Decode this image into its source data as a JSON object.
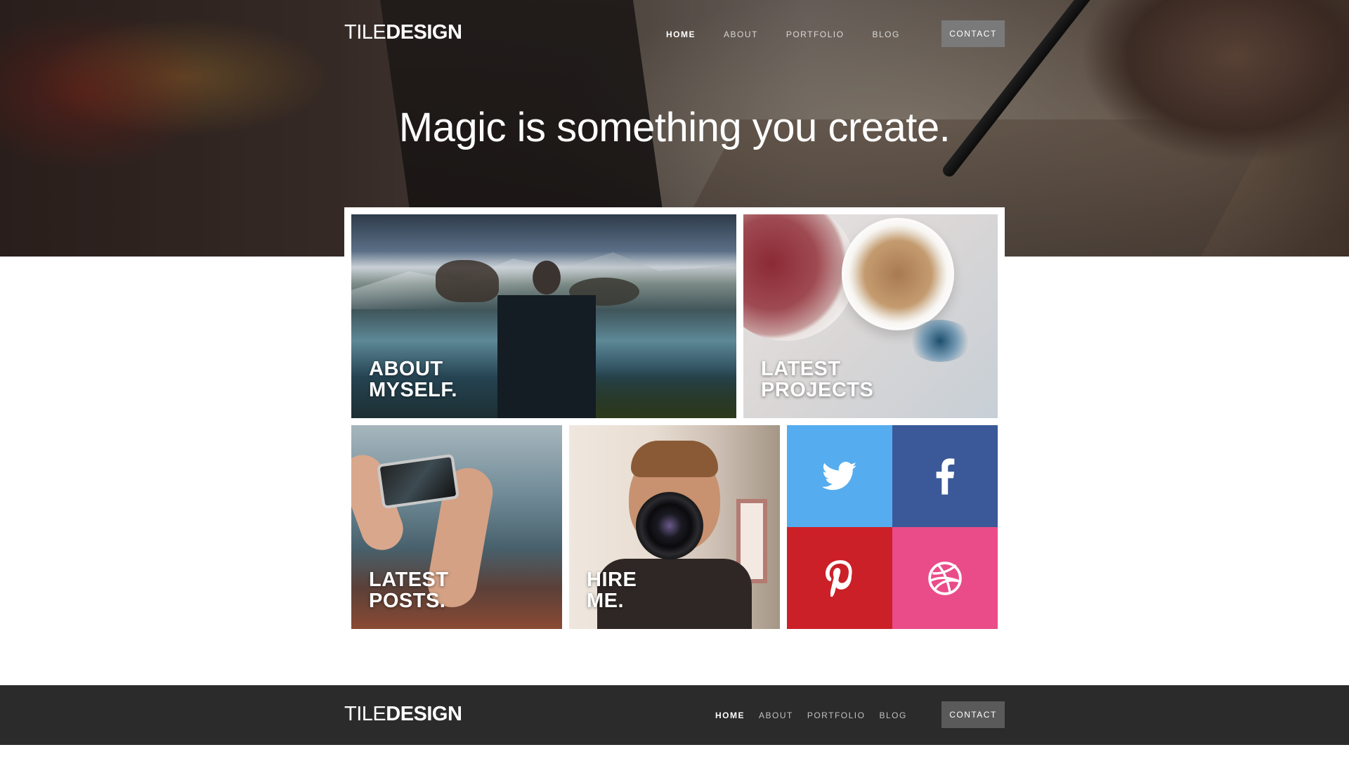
{
  "header": {
    "logo": {
      "thin": "TILE",
      "bold": "DESIGN"
    },
    "nav": [
      {
        "label": "HOME",
        "active": true
      },
      {
        "label": "ABOUT",
        "active": false
      },
      {
        "label": "PORTFOLIO",
        "active": false
      },
      {
        "label": "BLOG",
        "active": false
      }
    ],
    "contact_label": "CONTACT"
  },
  "hero": {
    "title": "Magic is something you create."
  },
  "tiles": {
    "about": {
      "line1": "ABOUT",
      "line2": "MYSELF."
    },
    "projects": {
      "line1": "LATEST",
      "line2": "PROJECTS"
    },
    "posts": {
      "line1": "LATEST",
      "line2": "POSTS."
    },
    "hire": {
      "line1": "HIRE",
      "line2": "ME."
    }
  },
  "social": [
    {
      "name": "twitter",
      "icon": "twitter-icon",
      "color": "#55acee"
    },
    {
      "name": "facebook",
      "icon": "facebook-icon",
      "color": "#3b5998"
    },
    {
      "name": "pinterest",
      "icon": "pinterest-icon",
      "color": "#cb2027"
    },
    {
      "name": "dribbble",
      "icon": "dribbble-icon",
      "color": "#ea4c89"
    }
  ],
  "footer": {
    "logo": {
      "thin": "TILE",
      "bold": "DESIGN"
    },
    "nav": [
      {
        "label": "HOME",
        "active": true
      },
      {
        "label": "ABOUT",
        "active": false
      },
      {
        "label": "PORTFOLIO",
        "active": false
      },
      {
        "label": "BLOG",
        "active": false
      }
    ],
    "contact_label": "CONTACT"
  },
  "colors": {
    "contact_button_bg": "#777777",
    "footer_contact_bg": "#5a5a5a",
    "footer_bg": "#2b2b2b"
  }
}
